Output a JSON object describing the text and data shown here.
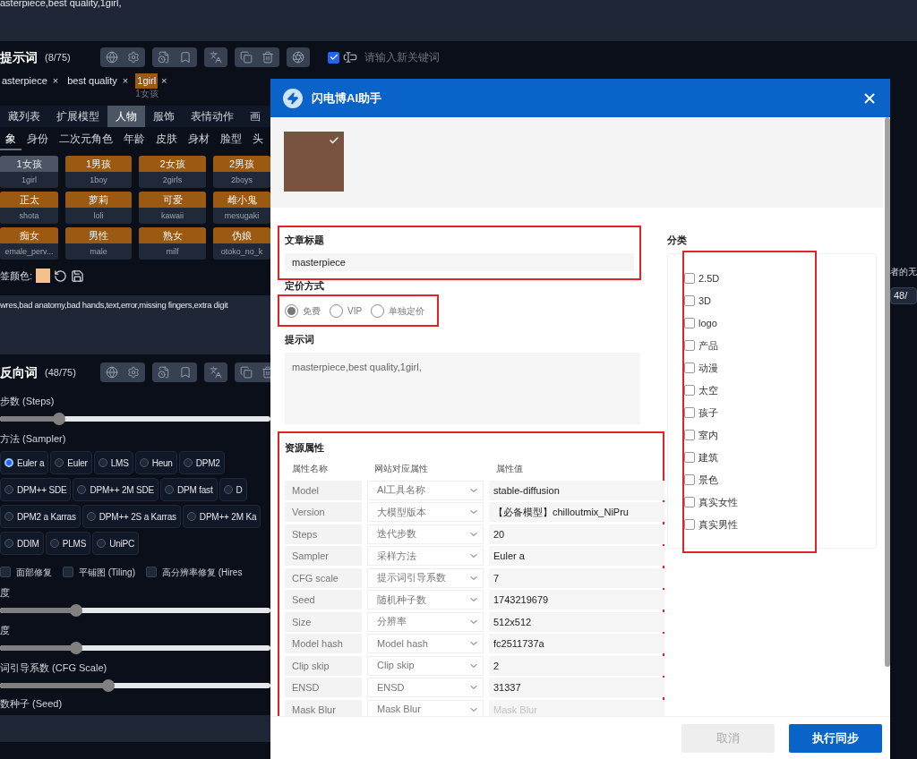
{
  "prompt_box": {
    "value": "asterpiece,best quality,1girl,"
  },
  "prompt_header": {
    "title": "提示词",
    "count": "(8/75)"
  },
  "keyword_input": {
    "checked": true,
    "placeholder": "请输入新关键词"
  },
  "tags": [
    {
      "label": "asterpiece",
      "highlighted": false
    },
    {
      "label": "best quality",
      "highlighted": false
    },
    {
      "label": "1girl",
      "highlighted": true,
      "note": "1女孩"
    }
  ],
  "close_mark": "×",
  "category_tabs": [
    {
      "label": "藏列表",
      "selected": false
    },
    {
      "label": "扩展模型",
      "selected": false
    },
    {
      "label": "人物",
      "selected": true
    },
    {
      "label": "服饰",
      "selected": false
    },
    {
      "label": "表情动作",
      "selected": false
    },
    {
      "label": "画",
      "selected": false
    }
  ],
  "sub_tabs": [
    {
      "label": "象",
      "selected": true
    },
    {
      "label": "身份",
      "selected": false
    },
    {
      "label": "二次元角色",
      "selected": false
    },
    {
      "label": "年龄",
      "selected": false
    },
    {
      "label": "皮肤",
      "selected": false
    },
    {
      "label": "身材",
      "selected": false
    },
    {
      "label": "脸型",
      "selected": false
    },
    {
      "label": "头",
      "selected": false
    }
  ],
  "cards": [
    {
      "name": "1女孩",
      "tag": "1girl",
      "selected": true
    },
    {
      "name": "1男孩",
      "tag": "1boy",
      "selected": false
    },
    {
      "name": "2女孩",
      "tag": "2girls",
      "selected": false
    },
    {
      "name": "2男孩",
      "tag": "2boys",
      "selected": false
    },
    {
      "name": "正太",
      "tag": "shota",
      "selected": false
    },
    {
      "name": "萝莉",
      "tag": "loli",
      "selected": false
    },
    {
      "name": "可爱",
      "tag": "kawaii",
      "selected": false
    },
    {
      "name": "雌小鬼",
      "tag": "mesugaki",
      "selected": false
    },
    {
      "name": "痴女",
      "tag": "emale_perv...",
      "selected": false
    },
    {
      "name": "男性",
      "tag": "male",
      "selected": false
    },
    {
      "name": "熟女",
      "tag": "milf",
      "selected": false
    },
    {
      "name": "伪娘",
      "tag": "otoko_no_k",
      "selected": false
    }
  ],
  "color_row": {
    "label": "签颜色:"
  },
  "negative_box": {
    "value": "wres,bad anatomy,bad hands,text,error,missing fingers,extra digit"
  },
  "negative_header": {
    "title": "反向词",
    "count": "(48/75)"
  },
  "steps": {
    "label": "步数 (Steps)",
    "level": 0.22
  },
  "sampler": {
    "label": "方法 (Sampler)",
    "rows": [
      {
        "options": [
          {
            "label": "Euler a",
            "selected": true
          },
          {
            "label": "Euler",
            "selected": false
          },
          {
            "label": "LMS",
            "selected": false
          },
          {
            "label": "Heun",
            "selected": false
          },
          {
            "label": "DPM2",
            "selected": false
          }
        ]
      },
      {
        "options": [
          {
            "label": "DPM++ SDE",
            "selected": false
          },
          {
            "label": "DPM++ 2M SDE",
            "selected": false
          },
          {
            "label": "DPM fast",
            "selected": false
          },
          {
            "label": "D",
            "selected": false
          }
        ]
      },
      {
        "options": [
          {
            "label": "DPM2 a Karras",
            "selected": false
          },
          {
            "label": "DPM++ 2S a Karras",
            "selected": false
          },
          {
            "label": "DPM++ 2M Ka",
            "selected": false
          }
        ]
      },
      {
        "options": [
          {
            "label": "DDIM",
            "selected": false
          },
          {
            "label": "PLMS",
            "selected": false
          },
          {
            "label": "UniPC",
            "selected": false
          }
        ]
      }
    ]
  },
  "options": [
    {
      "label": "面部修复",
      "checked": false
    },
    {
      "label": "平铺图 (Tiling)",
      "checked": false
    },
    {
      "label": "高分辨率修复 (Hires",
      "checked": false
    }
  ],
  "sliders": [
    {
      "label": "度",
      "level": 0.28
    },
    {
      "label": "度",
      "level": 0.28
    },
    {
      "label": "词引导系数 (CFG Scale)",
      "level": 0.4
    }
  ],
  "seed": {
    "label": "数种子 (Seed)"
  },
  "right_strip": {
    "note": "者的无",
    "count": "48/"
  },
  "dialog": {
    "title": "闪电博AI助手",
    "image_checked": true,
    "title_field": {
      "label": "文章标题",
      "value": "masterpiece"
    },
    "pricing": {
      "label": "定价方式",
      "options": [
        {
          "label": "免费",
          "selected": true
        },
        {
          "label": "VIP",
          "selected": false
        },
        {
          "label": "单独定价",
          "selected": false
        }
      ]
    },
    "prompt_field": {
      "label": "提示词",
      "value": "masterpiece,best quality,1girl,"
    },
    "resources": {
      "title": "资源属性",
      "columns": [
        "属性名称",
        "网站对应属性",
        "属性值"
      ],
      "rows": [
        {
          "name": "Model",
          "mapping": "AI工具名称",
          "value": "stable-diffusion"
        },
        {
          "name": "Version",
          "mapping": "大模型版本",
          "value": "【必备模型】chilloutmix_NiPru"
        },
        {
          "name": "Steps",
          "mapping": "迭代步数",
          "value": "20"
        },
        {
          "name": "Sampler",
          "mapping": "采样方法",
          "value": "Euler a"
        },
        {
          "name": "CFG scale",
          "mapping": "提示词引导系数",
          "value": "7"
        },
        {
          "name": "Seed",
          "mapping": "随机种子数",
          "value": "1743219679"
        },
        {
          "name": "Size",
          "mapping": "分辨率",
          "value": "512x512"
        },
        {
          "name": "Model hash",
          "mapping": "Model hash",
          "value": "fc2511737a"
        },
        {
          "name": "Clip skip",
          "mapping": "Clip skip",
          "value": "2"
        },
        {
          "name": "ENSD",
          "mapping": "ENSD",
          "value": "31337"
        },
        {
          "name": "Mask Blur",
          "mapping": "Mask Blur",
          "placeholder": "Mask Blur"
        }
      ]
    },
    "categories": {
      "label": "分类",
      "items": [
        {
          "label": "2.5D",
          "checked": false
        },
        {
          "label": "3D",
          "checked": false
        },
        {
          "label": "logo",
          "checked": false
        },
        {
          "label": "产品",
          "checked": false
        },
        {
          "label": "动漫",
          "checked": false
        },
        {
          "label": "太空",
          "checked": false
        },
        {
          "label": "孩子",
          "checked": false
        },
        {
          "label": "室内",
          "checked": false
        },
        {
          "label": "建筑",
          "checked": false
        },
        {
          "label": "景色",
          "checked": false
        },
        {
          "label": "真实女性",
          "checked": false
        },
        {
          "label": "真实男性",
          "checked": false
        }
      ]
    },
    "buttons": [
      {
        "label": "取消",
        "disabled": true
      },
      {
        "label": "执行同步",
        "disabled": false
      }
    ]
  }
}
